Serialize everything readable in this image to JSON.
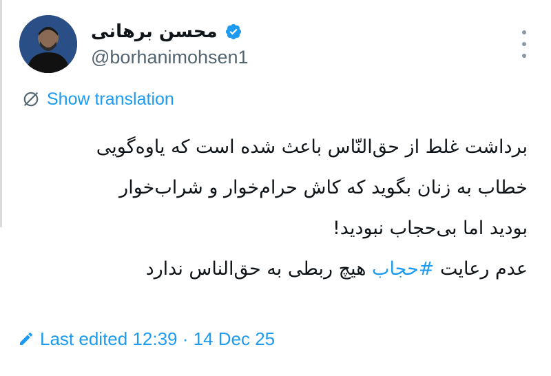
{
  "author": {
    "display_name": "محسن برهانی",
    "handle": "@borhanimohsen1",
    "verified": true
  },
  "translate": {
    "label": "Show translation"
  },
  "tweet": {
    "line1": "برداشت غلط از حق‌النّاس باعث شده است که یاوه‌گویی",
    "line2": "خطاب به زنان بگوید که کاش حرام‌خوار و شراب‌خوار",
    "line3": "بودید اما بی‌حجاب نبودید!",
    "line4_before": "عدم رعایت ",
    "hashtag": "#حجاب",
    "line4_after": " هیچ ربطی به حق‌الناس ندارد"
  },
  "edited": {
    "label": "Last edited 12:39 · 14 Dec 25"
  },
  "colors": {
    "link": "#1d9bf0",
    "text": "#0f1419",
    "secondary": "#536471",
    "verified": "#1d9bf0"
  },
  "icons": {
    "verified": "verified-badge-icon",
    "translate": "translate-globe-icon",
    "edited": "pencil-icon",
    "more": "more-vertical-icon"
  }
}
